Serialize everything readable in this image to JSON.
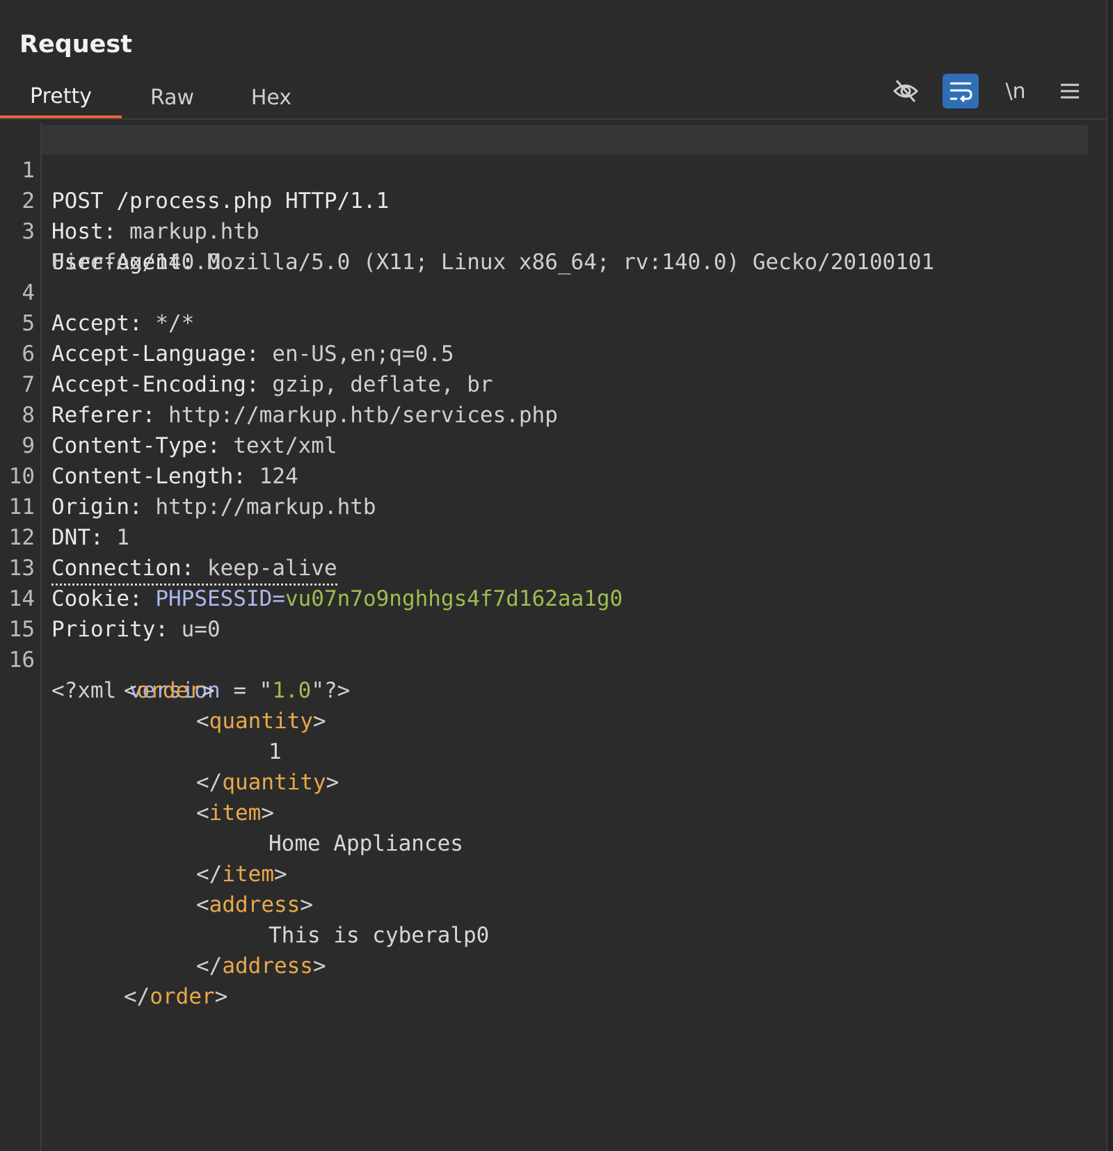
{
  "panel": {
    "title": "Request",
    "tabs": [
      {
        "label": "Pretty",
        "active": true
      },
      {
        "label": "Raw",
        "active": false
      },
      {
        "label": "Hex",
        "active": false
      }
    ],
    "toolbar": {
      "hide_icon": "eye-slash-icon",
      "wrap_icon": "word-wrap-icon",
      "newline_label": "\\n",
      "menu_icon": "hamburger-menu-icon"
    }
  },
  "colors": {
    "accent_tab": "#e8643a",
    "wrap_button": "#2f6fb6",
    "cookie_name": "#a9b7f0",
    "cookie_value": "#9bbf4f",
    "xml_tag": "#e8a94a"
  },
  "request": {
    "lines": [
      {
        "n": "1",
        "text": "POST /process.php HTTP/1.1"
      },
      {
        "n": "2",
        "name": "Host:",
        "value": " markup.htb"
      },
      {
        "n": "3",
        "name": "User-Agent:",
        "value": " Mozilla/5.0 (X11; Linux x86_64; rv:140.0) Gecko/20100101",
        "cont": "Firefox/140.0"
      },
      {
        "n": "4",
        "name": "Accept:",
        "value": " */*"
      },
      {
        "n": "5",
        "name": "Accept-Language:",
        "value": " en-US,en;q=0.5"
      },
      {
        "n": "6",
        "name": "Accept-Encoding:",
        "value": " gzip, deflate, br"
      },
      {
        "n": "7",
        "name": "Referer:",
        "value": " http://markup.htb/services.php"
      },
      {
        "n": "8",
        "name": "Content-Type:",
        "value": " text/xml"
      },
      {
        "n": "9",
        "name": "Content-Length:",
        "value": " 124"
      },
      {
        "n": "10",
        "name": "Origin:",
        "value": " http://markup.htb"
      },
      {
        "n": "11",
        "name": "DNT:",
        "value": " 1"
      },
      {
        "n": "12",
        "name": "Connection:",
        "value": " keep-alive"
      },
      {
        "n": "13",
        "name": "Cookie:",
        "cookie_name": "PHPSESSID=",
        "cookie_value": "vu07n7o9nghhgs4f7d162aa1g0"
      },
      {
        "n": "14",
        "name": "Priority:",
        "value": " u=0"
      },
      {
        "n": "15",
        "text": ""
      },
      {
        "n": "16"
      }
    ],
    "xml": {
      "decl_open": "<?xml",
      "decl_attr": "version",
      "decl_eq": " = ",
      "decl_q1": "\"",
      "decl_ver": "1.0",
      "decl_close": "\"?>",
      "order": "order",
      "quantity": "quantity",
      "quantity_value": "1",
      "item": "item",
      "item_value": "Home Appliances",
      "address": "address",
      "address_value": "This is cyberalp0"
    }
  }
}
